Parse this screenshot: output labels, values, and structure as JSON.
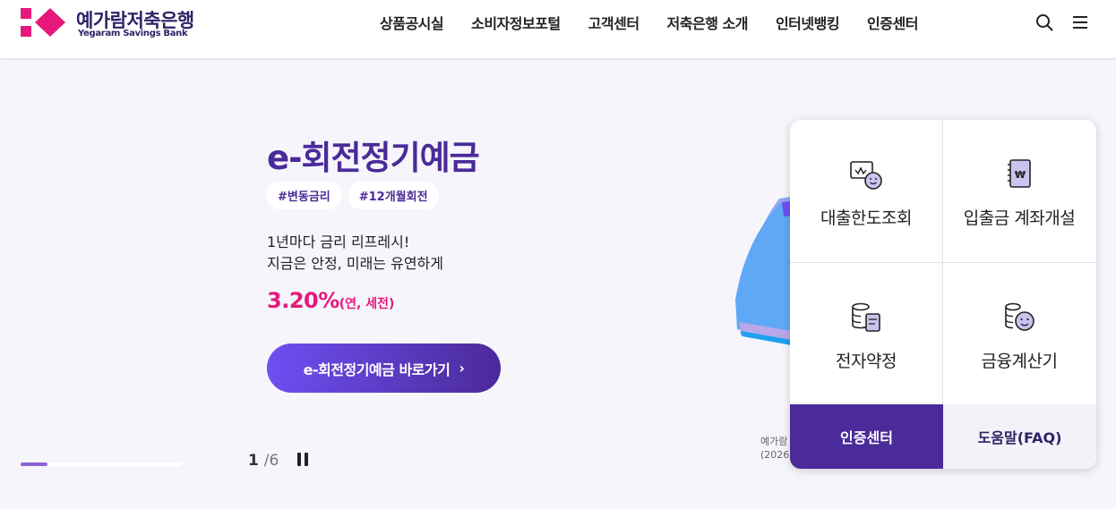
{
  "brand": {
    "name_ko": "예가람저축은행",
    "name_en": "Yegaram Savings Bank",
    "color_primary": "#4b2a99",
    "color_accent": "#e5197c"
  },
  "nav": {
    "items": [
      "상품공시실",
      "소비자정보포털",
      "고객센터",
      "저축은행 소개",
      "인터넷뱅킹",
      "인증센터"
    ],
    "search_icon": "search-icon",
    "menu_icon": "hamburger-menu-icon"
  },
  "hero": {
    "title": "e-회전정기예금",
    "tags": [
      "#변동금리",
      "#12개월회전"
    ],
    "desc_line1": "1년마다 금리 리프레시!",
    "desc_line2": "지금은 안정, 미래는 유연하게",
    "rate": "3.20%",
    "rate_note": "(연, 세전)",
    "cta_label": "e-회전정기예금 바로가기",
    "note_line1": "예가람",
    "note_line2": "(2026."
  },
  "slider": {
    "current": "1",
    "separator": "/",
    "total": "6",
    "progress_fraction": 0.1667
  },
  "quick_menu": {
    "items": [
      {
        "label": "대출한도조회",
        "icon": "loan-limit-icon"
      },
      {
        "label": "입출금 계좌개설",
        "icon": "passbook-icon"
      },
      {
        "label": "전자약정",
        "icon": "e-contract-icon"
      },
      {
        "label": "금융계산기",
        "icon": "calculator-icon"
      }
    ],
    "auth_button": "인증센터",
    "faq_button": "도움말(FAQ)"
  }
}
